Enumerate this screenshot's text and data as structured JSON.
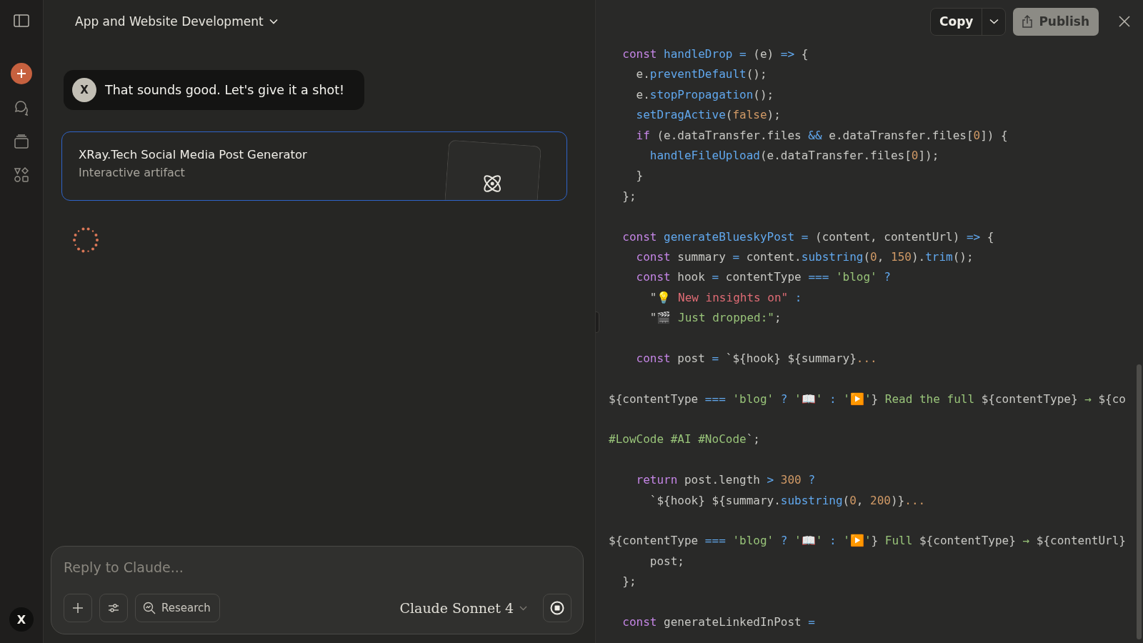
{
  "sidebar": {
    "avatar": "X"
  },
  "chat": {
    "title": "App and Website Development",
    "messages": [
      {
        "kind": "user",
        "avatar": "X",
        "text": "That sounds good. Let's give it a shot!"
      },
      {
        "kind": "artifact",
        "title": "XRay.Tech Social Media Post Generator",
        "subtitle": "Interactive artifact"
      },
      {
        "kind": "loading"
      }
    ],
    "composer": {
      "placeholder": "Reply to Claude...",
      "research": "Research",
      "model": "Claude Sonnet 4"
    }
  },
  "code_panel": {
    "copy": "Copy",
    "publish": "Publish",
    "lines": [
      {
        "tokens": [
          {
            "kind": "kw",
            "text": "  const "
          },
          {
            "kind": "fn",
            "text": "handleDrop "
          },
          {
            "kind": "op",
            "text": "="
          },
          {
            "kind": "p",
            "text": " (e) "
          },
          {
            "kind": "op",
            "text": "=>"
          },
          {
            "kind": "p",
            "text": " {"
          }
        ]
      },
      {
        "tokens": [
          {
            "kind": "p",
            "text": "    e."
          },
          {
            "kind": "fn",
            "text": "preventDefault"
          },
          {
            "kind": "p",
            "text": "();"
          }
        ]
      },
      {
        "tokens": [
          {
            "kind": "p",
            "text": "    e."
          },
          {
            "kind": "fn",
            "text": "stopPropagation"
          },
          {
            "kind": "p",
            "text": "();"
          }
        ]
      },
      {
        "tokens": [
          {
            "kind": "fn",
            "text": "    setDragActive"
          },
          {
            "kind": "p",
            "text": "("
          },
          {
            "kind": "num",
            "text": "false"
          },
          {
            "kind": "p",
            "text": ");"
          }
        ]
      },
      {
        "tokens": [
          {
            "kind": "kw",
            "text": "    if"
          },
          {
            "kind": "p",
            "text": " (e.dataTransfer.files "
          },
          {
            "kind": "op",
            "text": "&&"
          },
          {
            "kind": "p",
            "text": " e.dataTransfer.files["
          },
          {
            "kind": "num",
            "text": "0"
          },
          {
            "kind": "p",
            "text": "]) {"
          }
        ]
      },
      {
        "tokens": [
          {
            "kind": "fn",
            "text": "      handleFileUpload"
          },
          {
            "kind": "p",
            "text": "(e.dataTransfer.files["
          },
          {
            "kind": "num",
            "text": "0"
          },
          {
            "kind": "p",
            "text": "]);"
          }
        ]
      },
      {
        "tokens": [
          {
            "kind": "p",
            "text": "    }"
          }
        ]
      },
      {
        "tokens": [
          {
            "kind": "p",
            "text": "  };"
          }
        ]
      },
      {
        "blank_before": true,
        "tokens": [
          {
            "kind": "kw",
            "text": "  const "
          },
          {
            "kind": "fn",
            "text": "generateBlueskyPost "
          },
          {
            "kind": "op",
            "text": "="
          },
          {
            "kind": "p",
            "text": " (content, contentUrl) "
          },
          {
            "kind": "op",
            "text": "=>"
          },
          {
            "kind": "p",
            "text": " {"
          }
        ]
      },
      {
        "tokens": [
          {
            "kind": "kw",
            "text": "    const"
          },
          {
            "kind": "p",
            "text": " summary "
          },
          {
            "kind": "op",
            "text": "="
          },
          {
            "kind": "p",
            "text": " content."
          },
          {
            "kind": "fn",
            "text": "substring"
          },
          {
            "kind": "p",
            "text": "("
          },
          {
            "kind": "num",
            "text": "0"
          },
          {
            "kind": "p",
            "text": ", "
          },
          {
            "kind": "num",
            "text": "150"
          },
          {
            "kind": "p",
            "text": ")."
          },
          {
            "kind": "fn",
            "text": "trim"
          },
          {
            "kind": "p",
            "text": "();"
          }
        ]
      },
      {
        "tokens": [
          {
            "kind": "kw",
            "text": "    const"
          },
          {
            "kind": "p",
            "text": " hook "
          },
          {
            "kind": "op",
            "text": "="
          },
          {
            "kind": "p",
            "text": " contentType "
          },
          {
            "kind": "op",
            "text": "==="
          },
          {
            "kind": "str",
            "text": " 'blog' "
          },
          {
            "kind": "op",
            "text": "?"
          }
        ]
      },
      {
        "tokens": [
          {
            "kind": "p",
            "text": "      \""
          },
          {
            "kind": "red",
            "text": "💡 New insights on\" "
          },
          {
            "kind": "op",
            "text": ":"
          }
        ]
      },
      {
        "tokens": [
          {
            "kind": "p",
            "text": "      \""
          },
          {
            "kind": "str",
            "text": "🎬 Just dropped:\""
          },
          {
            "kind": "p",
            "text": ";"
          }
        ]
      },
      {
        "blank_before": true,
        "tokens": [
          {
            "kind": "kw",
            "text": "    const"
          },
          {
            "kind": "p",
            "text": " post "
          },
          {
            "kind": "op",
            "text": "="
          },
          {
            "kind": "p",
            "text": " `${hook} ${summary}"
          },
          {
            "kind": "num",
            "text": "..."
          }
        ]
      },
      {
        "blank_before": true,
        "tokens": [
          {
            "kind": "p",
            "text": "${contentType "
          },
          {
            "kind": "op",
            "text": "==="
          },
          {
            "kind": "str",
            "text": " 'blog' "
          },
          {
            "kind": "op",
            "text": "?"
          },
          {
            "kind": "str",
            "text": " '📖' "
          },
          {
            "kind": "op",
            "text": ":"
          },
          {
            "kind": "str",
            "text": " '▶️'"
          },
          {
            "kind": "p",
            "text": "} "
          },
          {
            "kind": "str",
            "text": "Read the full"
          },
          {
            "kind": "p",
            "text": " ${contentType} "
          },
          {
            "kind": "str",
            "text": "→"
          },
          {
            "kind": "p",
            "text": " ${co"
          }
        ]
      },
      {
        "blank_before": true,
        "tokens": [
          {
            "kind": "str",
            "text": "#LowCode #AI #NoCode"
          },
          {
            "kind": "p",
            "text": "`;"
          }
        ]
      },
      {
        "blank_before": true,
        "tokens": [
          {
            "kind": "kw",
            "text": "    return"
          },
          {
            "kind": "p",
            "text": " post.length "
          },
          {
            "kind": "op",
            "text": ">"
          },
          {
            "kind": "num",
            "text": " 300 "
          },
          {
            "kind": "op",
            "text": "?"
          }
        ]
      },
      {
        "tokens": [
          {
            "kind": "p",
            "text": "      `${hook} ${summary."
          },
          {
            "kind": "fn",
            "text": "substring"
          },
          {
            "kind": "p",
            "text": "("
          },
          {
            "kind": "num",
            "text": "0"
          },
          {
            "kind": "p",
            "text": ", "
          },
          {
            "kind": "num",
            "text": "200"
          },
          {
            "kind": "p",
            "text": ")}"
          },
          {
            "kind": "num",
            "text": "..."
          }
        ]
      },
      {
        "blank_before": true,
        "tokens": [
          {
            "kind": "p",
            "text": "${contentType "
          },
          {
            "kind": "op",
            "text": "==="
          },
          {
            "kind": "str",
            "text": " 'blog' "
          },
          {
            "kind": "op",
            "text": "?"
          },
          {
            "kind": "str",
            "text": " '📖' "
          },
          {
            "kind": "op",
            "text": ":"
          },
          {
            "kind": "str",
            "text": " '▶️'"
          },
          {
            "kind": "p",
            "text": "} "
          },
          {
            "kind": "str",
            "text": "Full"
          },
          {
            "kind": "p",
            "text": " ${contentType} "
          },
          {
            "kind": "str",
            "text": "→"
          },
          {
            "kind": "p",
            "text": " ${contentUrl}"
          }
        ]
      },
      {
        "tokens": [
          {
            "kind": "p",
            "text": "      post;"
          }
        ]
      },
      {
        "tokens": [
          {
            "kind": "p",
            "text": "  };"
          }
        ]
      },
      {
        "blank_before": true,
        "tokens": [
          {
            "kind": "kw",
            "text": "  const"
          },
          {
            "kind": "p",
            "text": " generateLinkedInPost "
          },
          {
            "kind": "op",
            "text": "="
          }
        ]
      }
    ]
  }
}
